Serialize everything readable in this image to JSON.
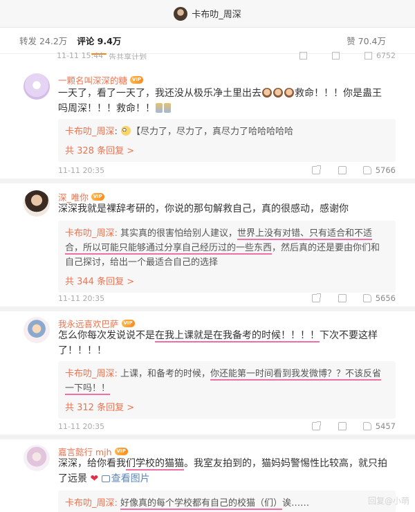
{
  "topbar": {
    "title": "卡布叻_周深"
  },
  "stats": {
    "repost": "转发 24.2万",
    "comments": "评论 9.4万",
    "likes": "赞 70.4万"
  },
  "peek": {
    "time": "11-11 15:44",
    "source": "告共享计划",
    "likes": "6752"
  },
  "comments": [
    {
      "user": "一颗名叫深深的糖",
      "vip": "VIP",
      "text_a": "一天了，看了一天了，我还没从极乐净土里出去",
      "text_b": "救命！！！你是蛊王吗周深！！！救命！！",
      "reply_name": "卡布叻_周深",
      "reply_sep": ":",
      "reply_text": "【尽力了，尽力了，真尽力了哈哈哈哈哈",
      "reply_count": "共 328 条回复 >",
      "time": "11-11 20:35",
      "likes": "5766"
    },
    {
      "user": "深_唯你",
      "vip": "VIP",
      "text": "深深我就是裸辞考研的，你说的那句解救自己，真的很感动，感谢你",
      "reply_name": "卡布叻_周深",
      "reply_sep": ":",
      "r1": " 其实真的很害怕给别人建议，",
      "r2": "世界上没有对错、只有适合和不适合",
      "r3": "，所以可能只能够通过分享自己经历过的一些东西",
      "r4": "，然后真的还是要由你们和自己探讨，给出一个最适合自己的选择",
      "reply_count": "共 344 条回复 >",
      "time": "11-11 20:35",
      "likes": "5656"
    },
    {
      "user": "我永远喜欢巴萨",
      "vip": "VIP",
      "t1": "怎么你每次发说说不是",
      "t2": "在我上课就是在我备考的时候！！！！",
      "t3": "下次不要这样了！！！！",
      "reply_name": "卡布叻_周深",
      "reply_sep": ":",
      "r1": " 上课，和备考的时候，",
      "r2": "你还能第一时间看到我发微博？？不该反省一下吗！！",
      "reply_count": "共 312 条回复 >",
      "time": "11-11 20:35",
      "likes": "5457"
    },
    {
      "user": "嘉言懿行 mjh",
      "vip": "VIP",
      "t1": "深深，给你看我",
      "t2": "们学校的猫猫",
      "t3": "。我室友拍到的，猫妈妈警惕性比较高，就只拍了远景",
      "heart": "❤",
      "img_link": "查看图片",
      "reply_name": "卡布叻_周深",
      "reply_sep": ":",
      "r1": " ",
      "r2": "好像真的每个学校都有自己的校猫（们）",
      "r3": "诶……"
    }
  ],
  "watermark": "回复@小萌"
}
